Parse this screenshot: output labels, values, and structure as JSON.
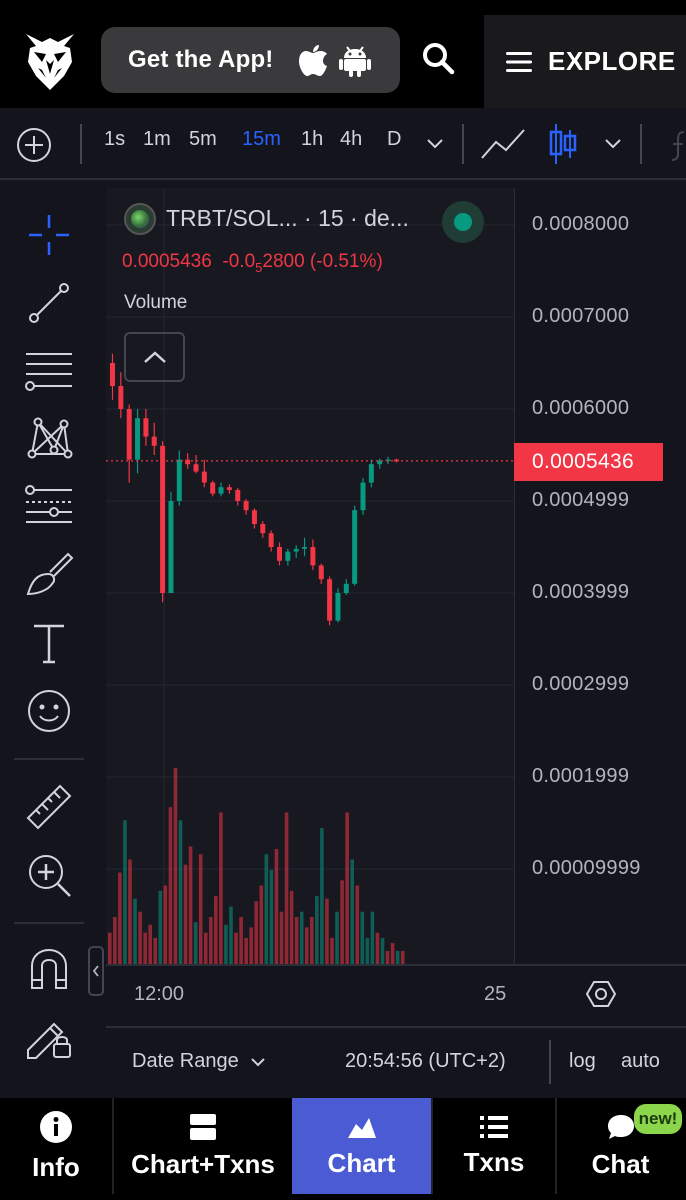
{
  "header": {
    "get_app_label": "Get the App!",
    "explore_label": "EXPLORE",
    "icons": [
      "owl-logo-icon",
      "apple-icon",
      "android-icon",
      "search-icon",
      "menu-icon"
    ]
  },
  "toolbar": {
    "intervals": [
      "1s",
      "1m",
      "5m",
      "15m",
      "1h",
      "4h",
      "D"
    ],
    "active_interval": "15m",
    "active_color": "#2962ff"
  },
  "chart": {
    "legend_title": "TRBT/SOL... · 15 · de...",
    "ohlc_price": "0.0005436",
    "ohlc_change_prefix": "-0.0",
    "ohlc_change_sub": "5",
    "ohlc_change_suffix": "2800 (-0.51%)",
    "volume_label": "Volume",
    "last_price": "0.0005436",
    "up_color": "#089981",
    "down_color": "#f23645",
    "time_labels": [
      "12:00",
      "25"
    ]
  },
  "chart_data": {
    "type": "candlestick",
    "price_axis_labels": [
      "0.0008000",
      "0.0007000",
      "0.0006000",
      "0.0004999",
      "0.0003999",
      "0.0002999",
      "0.0001999",
      "0.00009999"
    ],
    "last_price": 0.0005436,
    "candles": [
      {
        "o": 0.00065,
        "h": 0.00066,
        "l": 0.00061,
        "c": 0.000625
      },
      {
        "o": 0.000625,
        "h": 0.00064,
        "l": 0.00059,
        "c": 0.0006
      },
      {
        "o": 0.0006,
        "h": 0.000605,
        "l": 0.00052,
        "c": 0.000545
      },
      {
        "o": 0.000545,
        "h": 0.0006,
        "l": 0.00053,
        "c": 0.00059
      },
      {
        "o": 0.00059,
        "h": 0.0006,
        "l": 0.00056,
        "c": 0.00057
      },
      {
        "o": 0.00057,
        "h": 0.000585,
        "l": 0.00055,
        "c": 0.00056
      },
      {
        "o": 0.00056,
        "h": 0.000565,
        "l": 0.00039,
        "c": 0.0004
      },
      {
        "o": 0.0004,
        "h": 0.00051,
        "l": 0.0004,
        "c": 0.0005
      },
      {
        "o": 0.0005,
        "h": 0.000555,
        "l": 0.000495,
        "c": 0.000545
      },
      {
        "o": 0.000545,
        "h": 0.000552,
        "l": 0.000535,
        "c": 0.00054
      },
      {
        "o": 0.00054,
        "h": 0.00055,
        "l": 0.00053,
        "c": 0.000532
      },
      {
        "o": 0.000532,
        "h": 0.000545,
        "l": 0.000515,
        "c": 0.00052
      },
      {
        "o": 0.00052,
        "h": 0.000522,
        "l": 0.000505,
        "c": 0.000508
      },
      {
        "o": 0.000508,
        "h": 0.00052,
        "l": 0.000505,
        "c": 0.000515
      },
      {
        "o": 0.000515,
        "h": 0.000518,
        "l": 0.000508,
        "c": 0.000512
      },
      {
        "o": 0.000512,
        "h": 0.000514,
        "l": 0.000495,
        "c": 0.0005
      },
      {
        "o": 0.0005,
        "h": 0.000502,
        "l": 0.000485,
        "c": 0.00049
      },
      {
        "o": 0.00049,
        "h": 0.000492,
        "l": 0.00047,
        "c": 0.000475
      },
      {
        "o": 0.000475,
        "h": 0.000478,
        "l": 0.00046,
        "c": 0.000465
      },
      {
        "o": 0.000465,
        "h": 0.000468,
        "l": 0.000445,
        "c": 0.00045
      },
      {
        "o": 0.00045,
        "h": 0.000455,
        "l": 0.00043,
        "c": 0.000435
      },
      {
        "o": 0.000435,
        "h": 0.000448,
        "l": 0.00043,
        "c": 0.000445
      },
      {
        "o": 0.000445,
        "h": 0.000452,
        "l": 0.000438,
        "c": 0.000448
      },
      {
        "o": 0.000448,
        "h": 0.00046,
        "l": 0.00044,
        "c": 0.00045
      },
      {
        "o": 0.00045,
        "h": 0.000458,
        "l": 0.000425,
        "c": 0.00043
      },
      {
        "o": 0.00043,
        "h": 0.000432,
        "l": 0.00041,
        "c": 0.000415
      },
      {
        "o": 0.000415,
        "h": 0.000418,
        "l": 0.000365,
        "c": 0.00037
      },
      {
        "o": 0.00037,
        "h": 0.000405,
        "l": 0.000368,
        "c": 0.0004
      },
      {
        "o": 0.0004,
        "h": 0.000415,
        "l": 0.000398,
        "c": 0.00041
      },
      {
        "o": 0.00041,
        "h": 0.000495,
        "l": 0.000408,
        "c": 0.00049
      },
      {
        "o": 0.00049,
        "h": 0.000525,
        "l": 0.000485,
        "c": 0.00052
      },
      {
        "o": 0.00052,
        "h": 0.000545,
        "l": 0.000515,
        "c": 0.00054
      },
      {
        "o": 0.00054,
        "h": 0.000546,
        "l": 0.000535,
        "c": 0.000544
      },
      {
        "o": 0.000544,
        "h": 0.000548,
        "l": 0.00054,
        "c": 0.000545
      },
      {
        "o": 0.000545,
        "h": 0.000546,
        "l": 0.000542,
        "c": 0.000543
      }
    ],
    "volumes": [
      12,
      18,
      35,
      55,
      40,
      25,
      20,
      12,
      15,
      10,
      28,
      30,
      60,
      75,
      55,
      38,
      45,
      16,
      42,
      12,
      18,
      26,
      58,
      15,
      22,
      12,
      18,
      10,
      14,
      24,
      30,
      42,
      36,
      44,
      20,
      58,
      28,
      18,
      20,
      14,
      18,
      26,
      52,
      25,
      10,
      20,
      32,
      58,
      40,
      30,
      20,
      10,
      20,
      12,
      10,
      5,
      8,
      5,
      5
    ]
  },
  "footer_bar": {
    "date_range_label": "Date Range",
    "time_label": "20:54:56 (UTC+2)",
    "log_label": "log",
    "auto_label": "auto"
  },
  "nav": {
    "items": [
      {
        "label": "Info",
        "icon": "info-icon"
      },
      {
        "label": "Chart+Txns",
        "icon": "split-view-icon"
      },
      {
        "label": "Chart",
        "icon": "chart-icon"
      },
      {
        "label": "Txns",
        "icon": "list-icon"
      },
      {
        "label": "Chat",
        "icon": "chat-bubble-icon"
      }
    ],
    "active": "Chart",
    "active_color": "#4a5bd4",
    "new_badge": "new!",
    "badge_color": "#8bd64a"
  }
}
